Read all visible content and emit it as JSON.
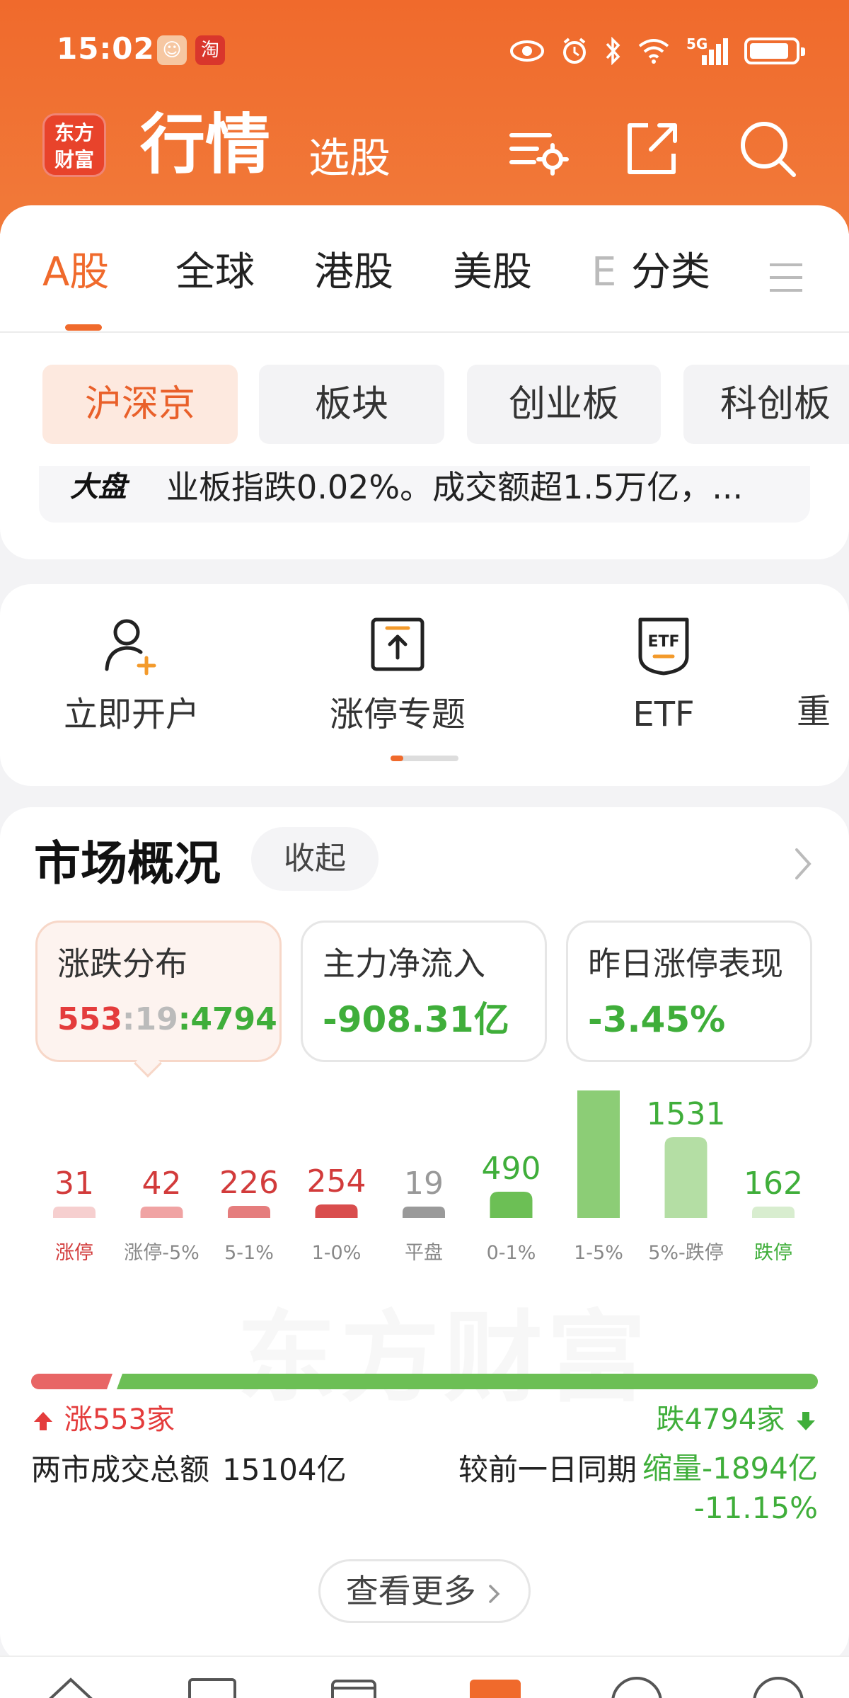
{
  "status_bar": {
    "time": "15:02",
    "network": "5G",
    "taobao_badge": "淘"
  },
  "header": {
    "logo_text_line1": "东方",
    "logo_text_line2": "财富",
    "title": "行情",
    "subtitle": "选股"
  },
  "tabs": [
    "A股",
    "全球",
    "港股",
    "美股",
    "E",
    "分类"
  ],
  "segments": [
    "沪深京",
    "板块",
    "创业板",
    "科创板"
  ],
  "news": {
    "tag": "大盘",
    "text": "业板指跌0.02%。成交额超1.5万亿，..."
  },
  "quick_actions": [
    "立即开户",
    "涨停专题",
    "ETF",
    "重"
  ],
  "market": {
    "title": "市场概况",
    "collapse_label": "收起",
    "stats": {
      "dist_label": "涨跌分布",
      "dist_up": "553",
      "dist_flat": "19",
      "dist_down": "4794",
      "flow_label": "主力净流入",
      "flow_value": "-908.31亿",
      "perf_label": "昨日涨停表现",
      "perf_value": "-3.45%"
    },
    "ratio": {
      "up_label": "涨553家",
      "down_label": "跌4794家",
      "up_fraction": 0.103
    },
    "turnover": {
      "label": "两市成交总额",
      "value": "15104亿",
      "compare_label": "较前一日同期",
      "compare_value": "缩量-1894亿",
      "compare_pct": "-11.15%"
    },
    "more_label": "查看更多"
  },
  "colors": {
    "brand": "#f06a2c",
    "up_red": "#e43c3c",
    "down_green": "#3fae3a"
  },
  "chart_data": {
    "type": "bar",
    "categories": [
      "涨停",
      "涨停-5%",
      "5-1%",
      "1-0%",
      "平盘",
      "0-1%",
      "1-5%",
      "5%-跌停",
      "跌停"
    ],
    "values": [
      31,
      42,
      226,
      254,
      19,
      490,
      2611,
      1531,
      162
    ],
    "colors": [
      "#f6cfcf",
      "#f0a3a3",
      "#e57d7d",
      "#d94d4d",
      "#9a9a9a",
      "#6cbf55",
      "#8ccd76",
      "#b4dea4",
      "#d8edcf"
    ],
    "label_colors": [
      "#d23b3b",
      "#d23b3b",
      "#d23b3b",
      "#d23b3b",
      "#999999",
      "#3fae3a",
      "#3fae3a",
      "#3fae3a",
      "#3fae3a"
    ],
    "category_colors": [
      "#d23b3b",
      "#888888",
      "#888888",
      "#888888",
      "#888888",
      "#888888",
      "#888888",
      "#888888",
      "#3fae3a"
    ]
  }
}
